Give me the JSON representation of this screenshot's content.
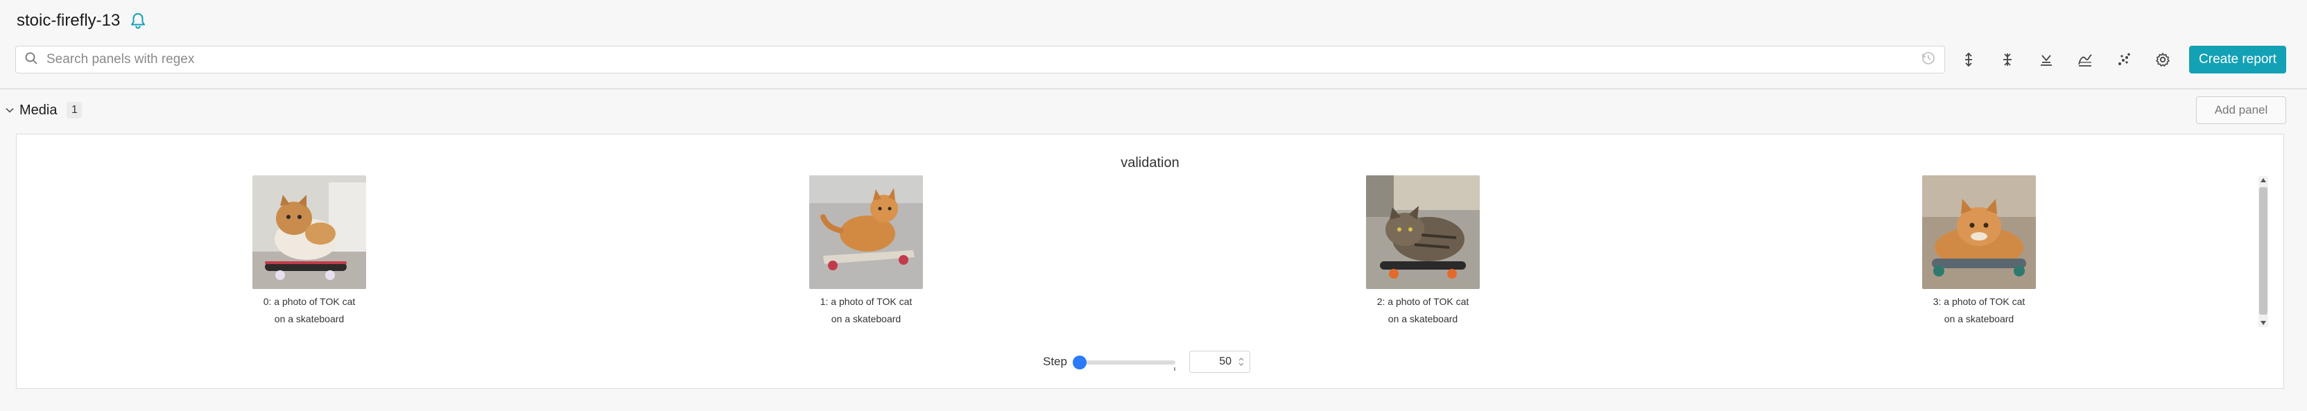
{
  "run": {
    "name": "stoic-firefly-13",
    "bell_icon": "bell-icon"
  },
  "search": {
    "placeholder": "Search panels with regex",
    "value": ""
  },
  "toolbar": {
    "icons": [
      "history-icon",
      "expand-vertical-icon",
      "collapse-icon",
      "ignore-outliers-icon",
      "smoothing-icon",
      "scatter-icon",
      "settings-gear-icon"
    ],
    "create_report_label": "Create report"
  },
  "section": {
    "title": "Media",
    "count": "1",
    "add_panel_label": "Add panel"
  },
  "panel": {
    "title": "validation",
    "items": [
      {
        "caption_line1": "0: a photo of TOK cat",
        "caption_line2": "on a skateboard"
      },
      {
        "caption_line1": "1: a photo of TOK cat",
        "caption_line2": "on a skateboard"
      },
      {
        "caption_line1": "2: a photo of TOK cat",
        "caption_line2": "on a skateboard"
      },
      {
        "caption_line1": "3: a photo of TOK cat",
        "caption_line2": "on a skateboard"
      }
    ],
    "step_label": "Step",
    "step_value": "50"
  },
  "colors": {
    "accent": "#13a1b5",
    "slider": "#2a7bf5"
  }
}
